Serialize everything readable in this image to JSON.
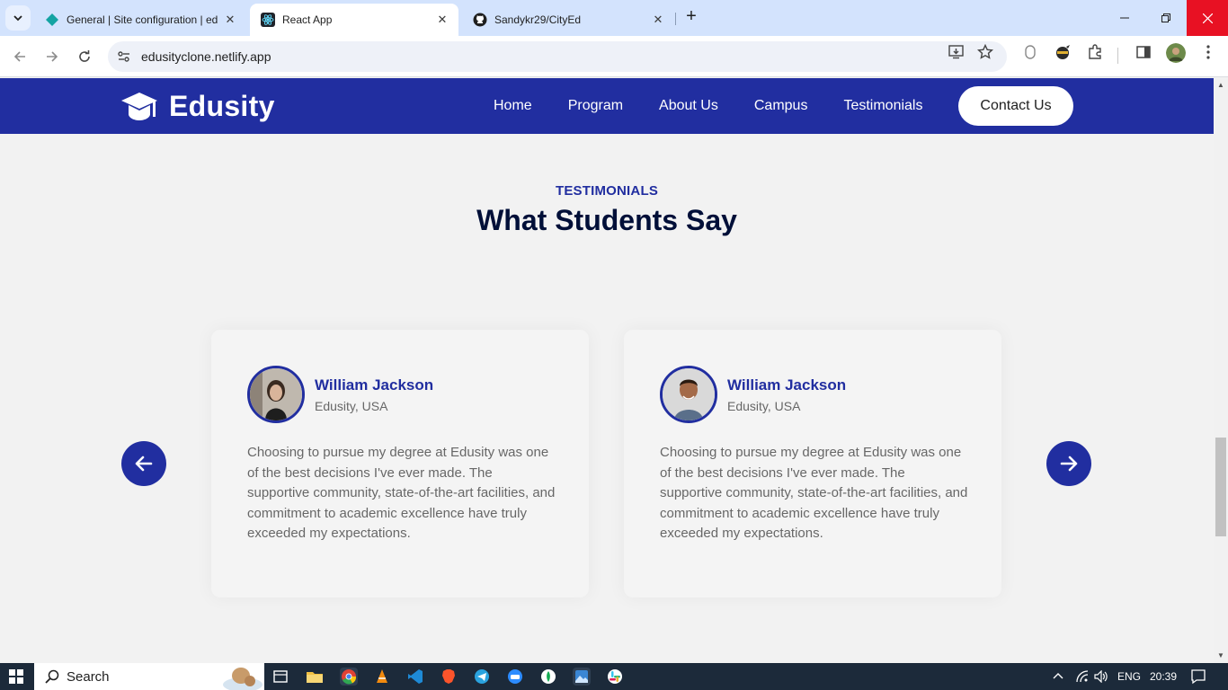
{
  "browser": {
    "tabs": [
      {
        "title": "General | Site configuration | ed",
        "active": false
      },
      {
        "title": "React App",
        "active": true
      },
      {
        "title": "Sandykr29/CityEd",
        "active": false
      }
    ],
    "url": "edusityclone.netlify.app"
  },
  "site": {
    "brand": "Edusity",
    "nav": [
      "Home",
      "Program",
      "About Us",
      "Campus",
      "Testimonials"
    ],
    "contact_label": "Contact Us",
    "colors": {
      "primary": "#212ea0",
      "heading": "#000f38",
      "body_text": "#676767"
    }
  },
  "testimonials": {
    "eyebrow": "TESTIMONIALS",
    "title": "What Students Say",
    "cards": [
      {
        "name": "William Jackson",
        "location": "Edusity, USA",
        "quote": "Choosing to pursue my degree at Edusity was one of the best decisions I've ever made. The supportive community, state-of-the-art facilities, and commitment to academic excellence have truly exceeded my expectations."
      },
      {
        "name": "William Jackson",
        "location": "Edusity, USA",
        "quote": "Choosing to pursue my degree at Edusity was one of the best decisions I've ever made. The supportive community, state-of-the-art facilities, and commitment to academic excellence have truly exceeded my expectations."
      }
    ]
  },
  "taskbar": {
    "search_label": "Search",
    "language": "ENG",
    "time": "20:39"
  }
}
